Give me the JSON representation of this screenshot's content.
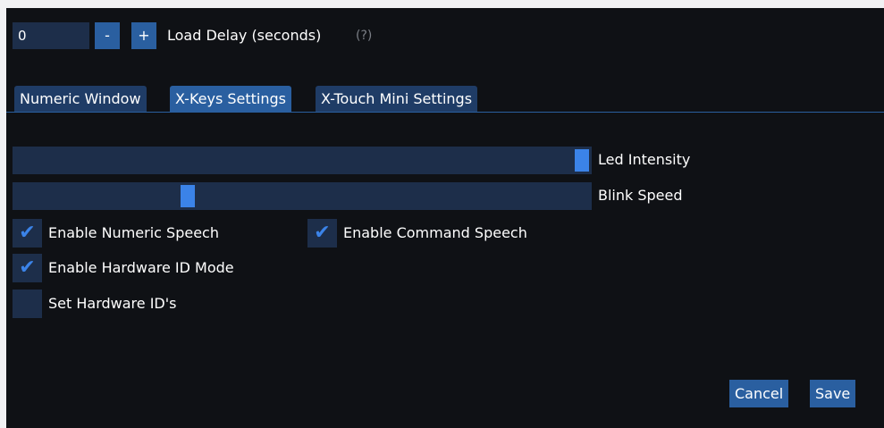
{
  "load_delay": {
    "value": "0",
    "minus_label": "-",
    "plus_label": "+",
    "label": "Load Delay (seconds)",
    "help": "(?)"
  },
  "tabs": [
    {
      "label": "Numeric Window",
      "active": false
    },
    {
      "label": "X-Keys Settings",
      "active": true
    },
    {
      "label": "X-Touch Mini Settings",
      "active": false
    }
  ],
  "sliders": {
    "led_intensity": {
      "label": "Led Intensity",
      "level": 1.0
    },
    "blink_speed": {
      "label": "Blink Speed",
      "level": 0.3
    }
  },
  "checkboxes": {
    "numeric_speech": {
      "label": "Enable Numeric Speech",
      "checked": true
    },
    "command_speech": {
      "label": "Enable Command Speech",
      "checked": true
    },
    "hardware_id_mode": {
      "label": "Enable Hardware ID Mode",
      "checked": true
    },
    "set_hardware_ids": {
      "label": "Set Hardware ID's",
      "checked": false
    }
  },
  "icons": {
    "check": "checkmark-icon"
  },
  "footer": {
    "cancel_label": "Cancel",
    "save_label": "Save"
  },
  "colors": {
    "background": "#0f1115",
    "frame": "#1d2e4a",
    "button": "#2a5fa0",
    "tab_inactive": "#1f3c66",
    "accent": "#3b83e8"
  }
}
